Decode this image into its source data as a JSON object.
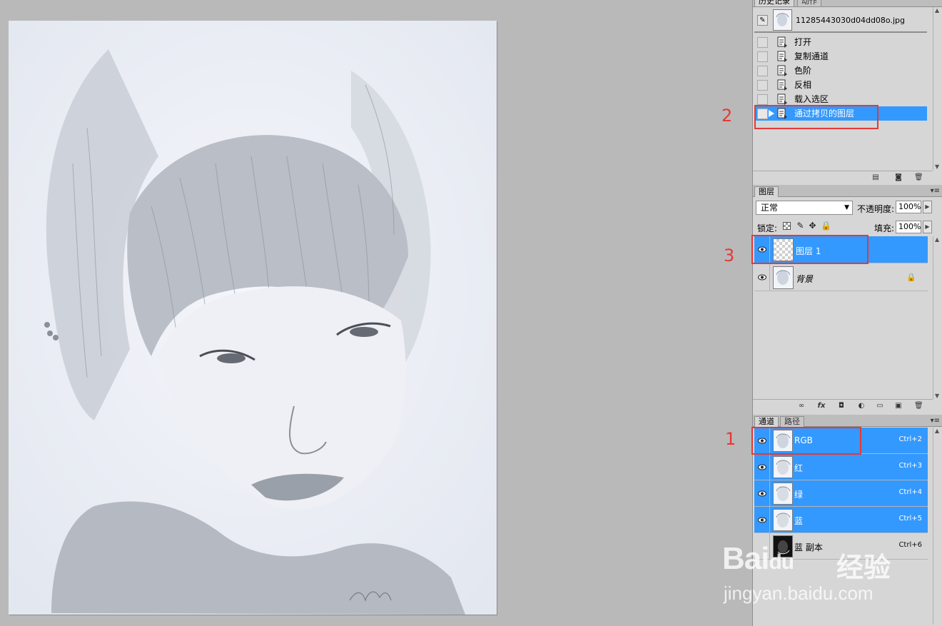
{
  "history": {
    "tabs": [
      "历史记录",
      "动作"
    ],
    "snapshot_name": "11285443030d04dd08o.jpg",
    "steps": [
      "打开",
      "复制通道",
      "色阶",
      "反相",
      "载入选区",
      "通过拷贝的图层"
    ],
    "selected_step": "通过拷贝的图层"
  },
  "layers": {
    "tab": "图层",
    "blend_mode": "正常",
    "opacity_label": "不透明度:",
    "opacity_value": "100%",
    "lock_label": "锁定:",
    "fill_label": "填充:",
    "fill_value": "100%",
    "items": [
      {
        "name": "图层 1",
        "selected": true
      },
      {
        "name": "背景",
        "selected": false,
        "locked": true
      }
    ]
  },
  "channels": {
    "tabs": [
      "通道",
      "路径"
    ],
    "items": [
      {
        "name": "RGB",
        "shortcut": "Ctrl+2"
      },
      {
        "name": "红",
        "shortcut": "Ctrl+3"
      },
      {
        "name": "绿",
        "shortcut": "Ctrl+4"
      },
      {
        "name": "蓝",
        "shortcut": "Ctrl+5"
      },
      {
        "name": "蓝 副本",
        "shortcut": "Ctrl+6"
      }
    ]
  },
  "annotations": [
    "1",
    "2",
    "3"
  ],
  "watermark": {
    "logo": "Bai",
    "logo_du": "du",
    "cn": "经验",
    "url": "jingyan.baidu.com"
  },
  "colors": {
    "selection": "#3399ff",
    "annotation": "#e53935",
    "canvas_bg": "#b9b9b9"
  }
}
